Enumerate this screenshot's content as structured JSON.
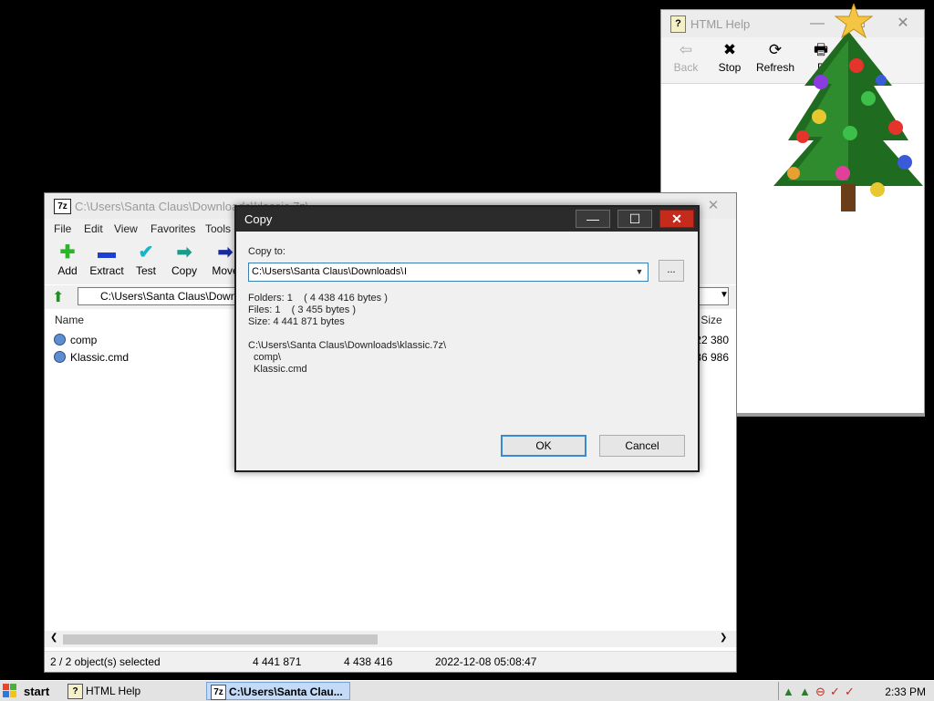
{
  "help_window": {
    "title": "HTML Help",
    "toolbar": [
      {
        "label": "Back",
        "icon": "back-arrow-icon",
        "glyph": "⇦",
        "disabled": true
      },
      {
        "label": "Stop",
        "icon": "stop-icon",
        "glyph": "✖",
        "disabled": false
      },
      {
        "label": "Refresh",
        "icon": "refresh-icon",
        "glyph": "⟳",
        "disabled": false
      },
      {
        "label": "P",
        "icon": "print-icon",
        "glyph": "🖶",
        "disabled": false
      }
    ]
  },
  "main_window": {
    "title": "C:\\Users\\Santa Claus\\Downloads\\klassic.7z\\",
    "menu": [
      "File",
      "Edit",
      "View",
      "Favorites",
      "Tools"
    ],
    "toolbar": [
      {
        "label": "Add",
        "icon": "add-plus-icon",
        "glyph": "✚",
        "color": "#2bb52b"
      },
      {
        "label": "Extract",
        "icon": "extract-minus-icon",
        "glyph": "▬",
        "color": "#1a3fd1"
      },
      {
        "label": "Test",
        "icon": "test-check-icon",
        "glyph": "✔",
        "color": "#16b6c6"
      },
      {
        "label": "Copy",
        "icon": "copy-arrow-icon",
        "glyph": "➡",
        "color": "#1a9a8a"
      },
      {
        "label": "Move",
        "icon": "move-arrow-icon",
        "glyph": "➡",
        "color": "#1a2c9a"
      }
    ],
    "address": "C:\\Users\\Santa Claus\\Downloads\\klassic.7z\\",
    "columns": {
      "name": "Name",
      "packed_size": "Packed Size"
    },
    "rows": [
      {
        "name": "comp",
        "packed": "4 022 380"
      },
      {
        "name": "Klassic.cmd",
        "packed": "86 986"
      }
    ],
    "status": {
      "selected": "2 / 2 object(s) selected",
      "size": "4 441 871",
      "packed": "4 438 416",
      "modified": "2022-12-08 05:08:47"
    }
  },
  "copy_dialog": {
    "title": "Copy",
    "copy_to_label": "Copy to:",
    "destination": "C:\\Users\\Santa Claus\\Downloads\\",
    "browse_label": "...",
    "folders_line": "Folders: 1    ( 4 438 416 bytes )",
    "files_line": "Files: 1    ( 3 455 bytes )",
    "size_line": "Size: 4 441 871 bytes",
    "archive_path": "C:\\Users\\Santa Claus\\Downloads\\klassic.7z\\",
    "items": [
      "comp\\",
      "Klassic.cmd"
    ],
    "ok_label": "OK",
    "cancel_label": "Cancel"
  },
  "taskbar": {
    "start_label": "start",
    "tasks": [
      {
        "label": "HTML Help",
        "icon": "help-icon"
      },
      {
        "label": "C:\\Users\\Santa Clau...",
        "icon": "7zip-icon",
        "active": true
      }
    ],
    "tray_icons": [
      "network-icon",
      "network-icon",
      "volume-icon",
      "check-icon",
      "check-icon"
    ],
    "clock": "2:33 PM"
  },
  "colors": {
    "dialog_titlebar": "#2b2b2b",
    "close_button": "#c42b1c",
    "ok_focus": "#3a8ad3",
    "taskbar": "#e3e3e3",
    "active_task": "#c3dbf7"
  }
}
